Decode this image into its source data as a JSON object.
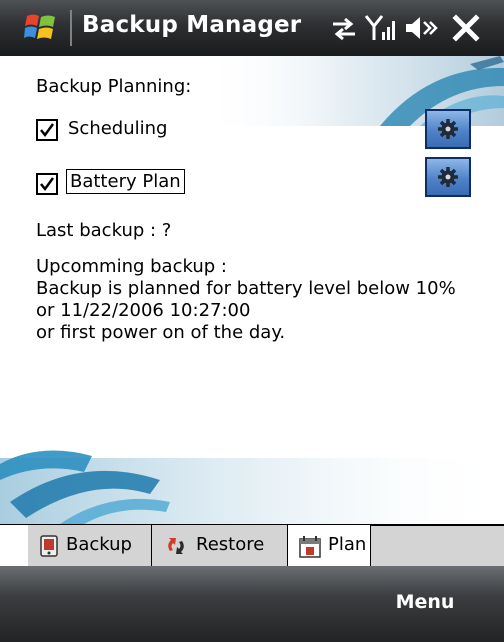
{
  "title_bar": {
    "title": "Backup Manager",
    "icons": [
      "windows-flag-icon",
      "connectivity-icon",
      "signal-icon",
      "volume-icon",
      "close-icon"
    ]
  },
  "content": {
    "heading": "Backup Planning:",
    "options": [
      {
        "label": "Scheduling",
        "checked": true,
        "settings_icon": "gear-icon"
      },
      {
        "label": "Battery Plan",
        "checked": true,
        "settings_icon": "gear-icon"
      }
    ],
    "last_backup": "Last backup : ?",
    "upcoming_heading": "Upcomming backup :",
    "upcoming_lines": [
      "Backup is planned for battery level below 10%",
      "or 11/22/2006 10:27:00",
      "or first power on of the day."
    ]
  },
  "tabs": [
    {
      "label": "Backup",
      "icon": "backup-icon",
      "active": false
    },
    {
      "label": "Restore",
      "icon": "restore-icon",
      "active": false
    },
    {
      "label": "Plan",
      "icon": "calendar-icon",
      "active": true
    }
  ],
  "softkeys": {
    "right": "Menu"
  },
  "colors": {
    "accent_blue": "#4f83c9",
    "title_bar": "#2d2f31",
    "tab_inactive": "#d4d4d4"
  }
}
